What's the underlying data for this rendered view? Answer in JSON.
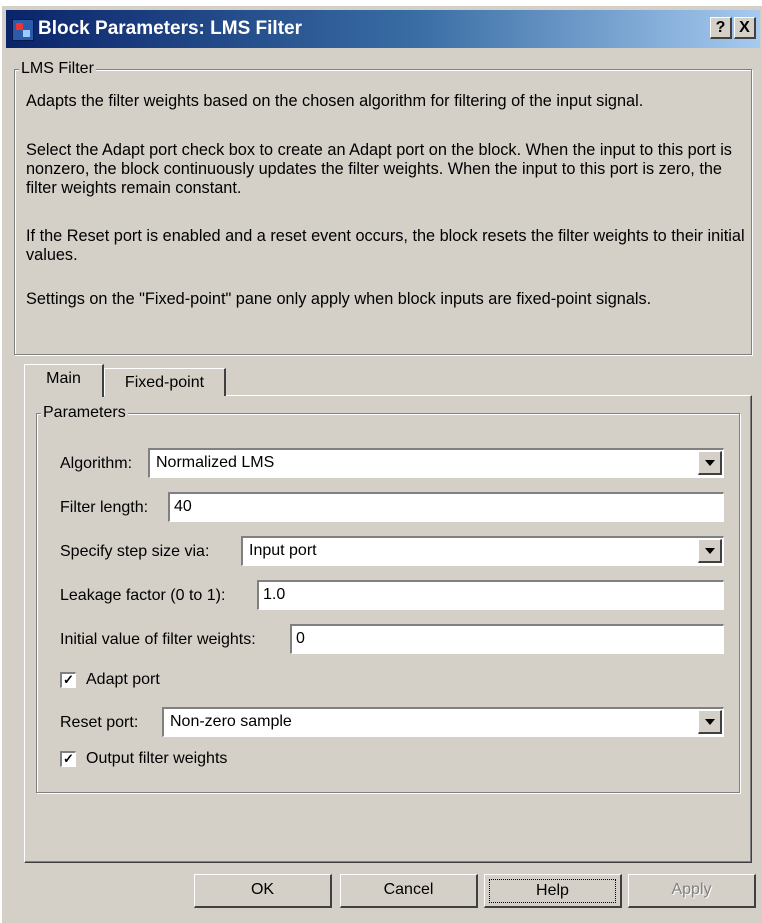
{
  "window": {
    "title": "Block Parameters: LMS Filter",
    "help_btn": "?",
    "close_btn": "X"
  },
  "desc_group": {
    "legend": "LMS Filter",
    "paragraphs": [
      "Adapts the filter weights based on the chosen algorithm for filtering of the input signal.",
      "Select the Adapt port check box to create an Adapt port on the block. When the input to this port is nonzero, the block continuously updates the filter weights. When the input to this port is zero, the filter weights remain constant.",
      "If the Reset port is enabled and a reset event occurs, the block resets the filter weights to their initial values.",
      "Settings on the \"Fixed-point\" pane only apply when block inputs are fixed-point signals."
    ]
  },
  "tabs": [
    {
      "label": "Main",
      "selected": true
    },
    {
      "label": "Fixed-point",
      "selected": false
    }
  ],
  "params": {
    "legend": "Parameters",
    "algorithm": {
      "label": "Algorithm:",
      "value": "Normalized LMS"
    },
    "filter_length": {
      "label": "Filter length:",
      "value": "40"
    },
    "step_size": {
      "label": "Specify step size via:",
      "value": "Input port"
    },
    "leakage": {
      "label": "Leakage factor (0 to 1):",
      "value": "1.0"
    },
    "initial_weights": {
      "label": "Initial value of filter weights:",
      "value": "0"
    },
    "adapt_port": {
      "label": "Adapt port",
      "checked": true
    },
    "reset_port": {
      "label": "Reset port:",
      "value": "Non-zero sample"
    },
    "output_weights": {
      "label": "Output filter weights",
      "checked": true
    }
  },
  "buttons": {
    "ok": "OK",
    "cancel": "Cancel",
    "help": "Help",
    "apply": "Apply"
  }
}
